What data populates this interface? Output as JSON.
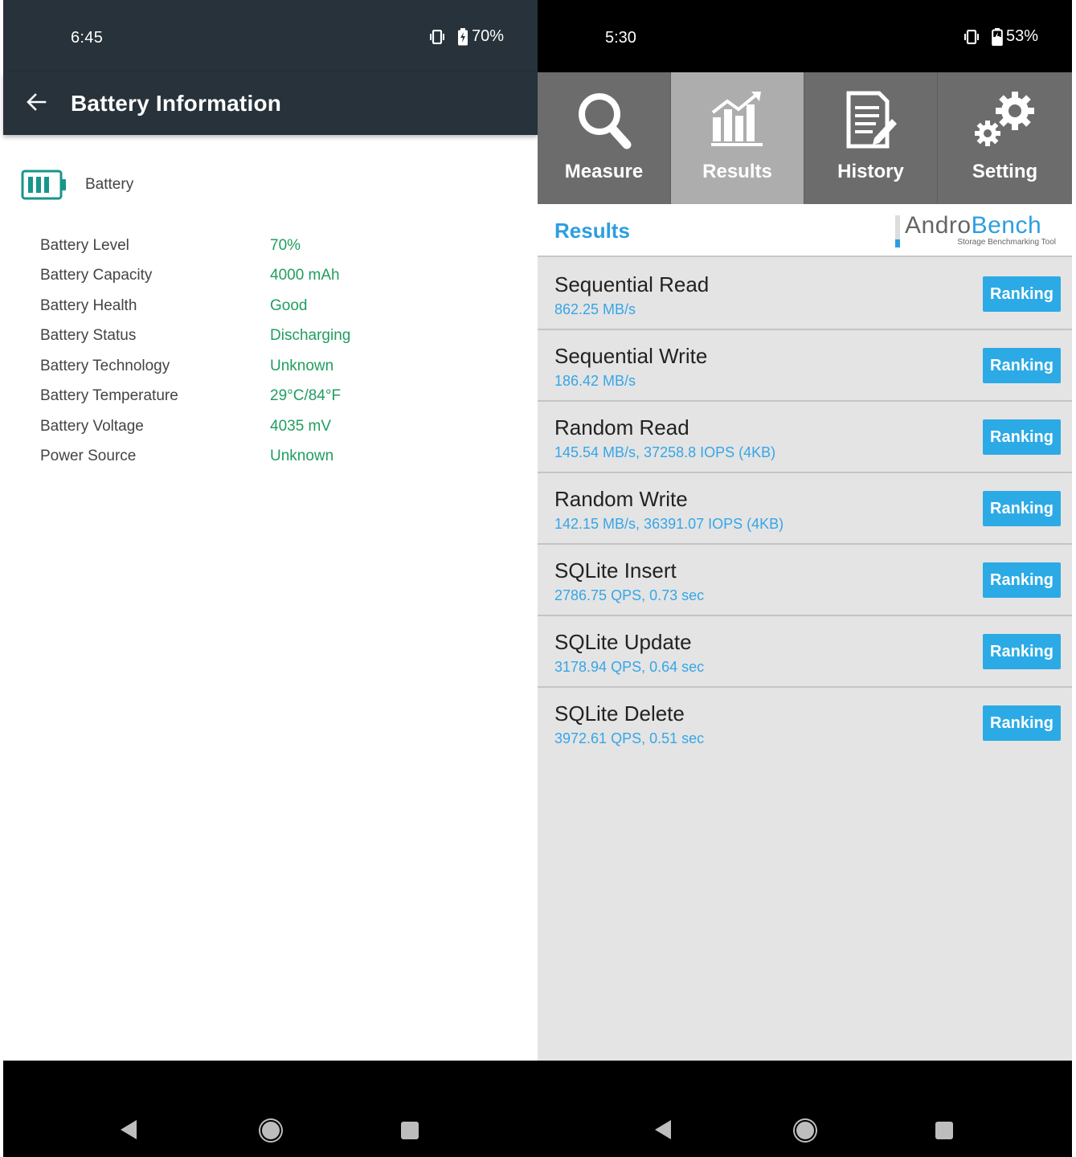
{
  "left": {
    "status": {
      "time": "6:45",
      "battery": "70%"
    },
    "appbar": {
      "title": "Battery Information"
    },
    "section": {
      "label": "Battery"
    },
    "rows": [
      {
        "key": "Battery Level",
        "value": "70%"
      },
      {
        "key": "Battery Capacity",
        "value": "4000 mAh"
      },
      {
        "key": "Battery Health",
        "value": "Good"
      },
      {
        "key": "Battery Status",
        "value": "Discharging"
      },
      {
        "key": "Battery Technology",
        "value": "Unknown"
      },
      {
        "key": "Battery Temperature",
        "value": "29°C/84°F"
      },
      {
        "key": "Battery Voltage",
        "value": "4035 mV"
      },
      {
        "key": "Power Source",
        "value": "Unknown"
      }
    ],
    "colors": {
      "appbar": "#27323a",
      "value_green": "#1f9e5e",
      "accent_teal": "#17968a"
    }
  },
  "right": {
    "status": {
      "time": "5:30",
      "battery": "53%"
    },
    "tabs": [
      {
        "label": "Measure",
        "icon": "magnifier-icon"
      },
      {
        "label": "Results",
        "icon": "bar-chart-icon",
        "active": true
      },
      {
        "label": "History",
        "icon": "document-pencil-icon"
      },
      {
        "label": "Setting",
        "icon": "gears-icon"
      }
    ],
    "header": {
      "title": "Results",
      "logo_part1": "Andro",
      "logo_part2": "Bench",
      "logo_tagline": "Storage Benchmarking Tool"
    },
    "results": [
      {
        "name": "Sequential Read",
        "value": "862.25 MB/s",
        "button": "Ranking"
      },
      {
        "name": "Sequential Write",
        "value": "186.42 MB/s",
        "button": "Ranking"
      },
      {
        "name": "Random Read",
        "value": "145.54 MB/s, 37258.8 IOPS (4KB)",
        "button": "Ranking"
      },
      {
        "name": "Random Write",
        "value": "142.15 MB/s, 36391.07 IOPS (4KB)",
        "button": "Ranking"
      },
      {
        "name": "SQLite Insert",
        "value": "2786.75 QPS, 0.73 sec",
        "button": "Ranking"
      },
      {
        "name": "SQLite Update",
        "value": "3178.94 QPS, 0.64 sec",
        "button": "Ranking"
      },
      {
        "name": "SQLite Delete",
        "value": "3972.61 QPS, 0.51 sec",
        "button": "Ranking"
      }
    ],
    "colors": {
      "accent_blue": "#2c9ee0",
      "button_blue": "#2caae6",
      "tab_bg": "#6c6c6c",
      "tab_active_bg": "#adadad"
    }
  },
  "navbar": {
    "icons": [
      "back-icon",
      "home-icon",
      "recents-icon"
    ]
  }
}
